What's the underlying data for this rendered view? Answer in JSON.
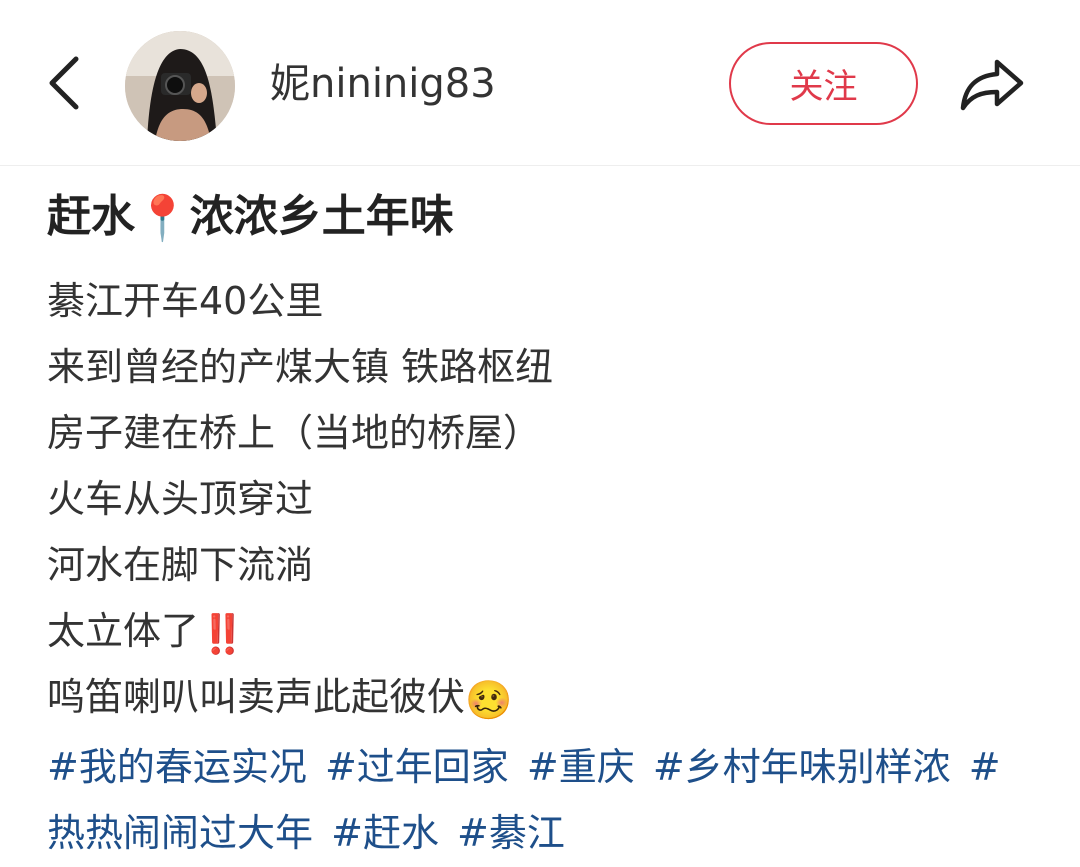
{
  "header": {
    "back_icon": "chevron-left-icon",
    "username": "妮nininig83",
    "follow_label": "关注",
    "share_icon": "share-arrow-icon",
    "accent_color": "#e0394a"
  },
  "post": {
    "title_part1": "赶水",
    "title_pin": "📍",
    "title_part2": "浓浓乡土年味",
    "lines": [
      "綦江开车40公里",
      "来到曾经的产煤大镇 铁路枢纽",
      "房子建在桥上（当地的桥屋）",
      "火车从头顶穿过",
      "河水在脚下流淌",
      "太立体了",
      "鸣笛喇叭叫卖声此起彼伏"
    ],
    "emoji_exclaim": "‼️",
    "emoji_face": "🥴",
    "tags": [
      "#我的春运实况",
      "#过年回家",
      "#重庆",
      "#乡村年味别样浓",
      "#热热闹闹过大年",
      "#赶水",
      "#綦江"
    ],
    "tag_color": "#1e4f8a"
  }
}
